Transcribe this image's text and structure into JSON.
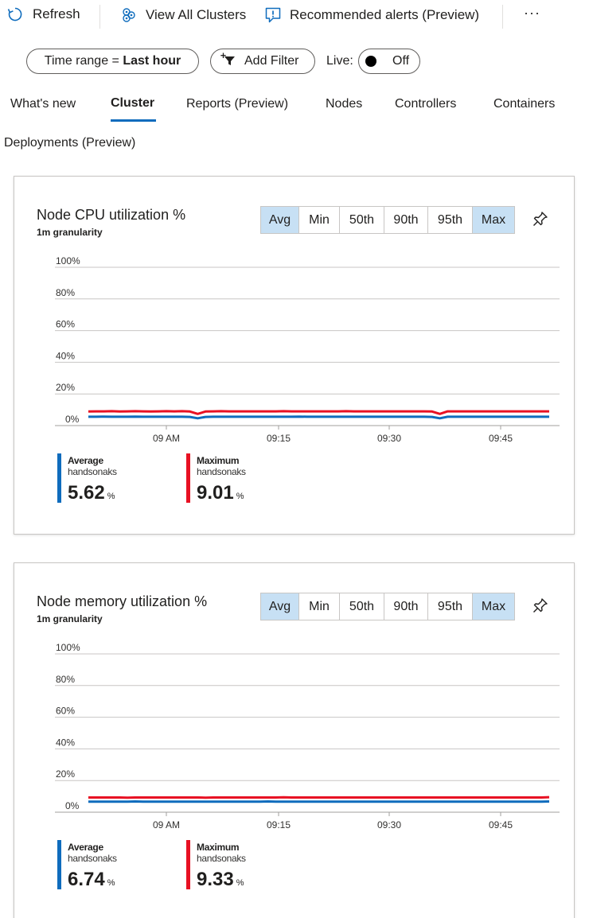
{
  "toolbar": {
    "refresh_label": "Refresh",
    "view_all_clusters_label": "View All Clusters",
    "recommended_alerts_label": "Recommended alerts (Preview)",
    "more_label": "···"
  },
  "filters": {
    "time_range_prefix": "Time range = ",
    "time_range_value": "Last hour",
    "add_filter_label": "Add Filter",
    "live_label": "Live:",
    "live_state": "Off"
  },
  "tabs": [
    {
      "label": "What's new",
      "active": false
    },
    {
      "label": "Cluster",
      "active": true
    },
    {
      "label": "Reports (Preview)",
      "active": false
    },
    {
      "label": "Nodes",
      "active": false
    },
    {
      "label": "Controllers",
      "active": false
    },
    {
      "label": "Containers",
      "active": false
    },
    {
      "label": "Deployments (Preview)",
      "active": false
    }
  ],
  "colors": {
    "accent": "#0f6cbd",
    "selected_segment": "#c7e0f4",
    "average_series": "#0f6cbd",
    "maximum_series": "#e81123"
  },
  "charts": [
    {
      "title": "Node CPU utilization %",
      "subtitle": "1m granularity",
      "aggregations": [
        {
          "label": "Avg",
          "selected": true
        },
        {
          "label": "Min",
          "selected": false
        },
        {
          "label": "50th",
          "selected": false
        },
        {
          "label": "90th",
          "selected": false
        },
        {
          "label": "95th",
          "selected": false
        },
        {
          "label": "Max",
          "selected": true
        }
      ],
      "legend": [
        {
          "name": "Average",
          "cluster": "handsonaks",
          "value": "5.62",
          "unit": "%"
        },
        {
          "name": "Maximum",
          "cluster": "handsonaks",
          "value": "9.01",
          "unit": "%"
        }
      ]
    },
    {
      "title": "Node memory utilization %",
      "subtitle": "1m granularity",
      "aggregations": [
        {
          "label": "Avg",
          "selected": true
        },
        {
          "label": "Min",
          "selected": false
        },
        {
          "label": "50th",
          "selected": false
        },
        {
          "label": "90th",
          "selected": false
        },
        {
          "label": "95th",
          "selected": false
        },
        {
          "label": "Max",
          "selected": true
        }
      ],
      "legend": [
        {
          "name": "Average",
          "cluster": "handsonaks",
          "value": "6.74",
          "unit": "%"
        },
        {
          "name": "Maximum",
          "cluster": "handsonaks",
          "value": "9.33",
          "unit": "%"
        }
      ]
    }
  ],
  "chart_data": [
    {
      "type": "line",
      "title": "Node CPU utilization %",
      "xlabel": "",
      "ylabel": "",
      "x_tick_labels": [
        "09 AM",
        "09:15",
        "09:30",
        "09:45"
      ],
      "y_tick_labels": [
        "0%",
        "20%",
        "40%",
        "60%",
        "80%",
        "100%"
      ],
      "ylim": [
        0,
        100
      ],
      "grid": true,
      "series": [
        {
          "name": "Average",
          "color": "#0f6cbd",
          "values": [
            5.6,
            5.6,
            5.7,
            5.6,
            5.6,
            5.6,
            5.7,
            5.6,
            5.6,
            5.6,
            5.6,
            5.6,
            5.6,
            5.5,
            4.6,
            5.5,
            5.6,
            5.6,
            5.6,
            5.6,
            5.6,
            5.6,
            5.6,
            5.6,
            5.6,
            5.6,
            5.6,
            5.7,
            5.6,
            5.6,
            5.6,
            5.6,
            5.6,
            5.6,
            5.6,
            5.6,
            5.6,
            5.6,
            5.6,
            5.6,
            5.6,
            5.6,
            5.6,
            5.6,
            5.5,
            4.6,
            5.6,
            5.6,
            5.6,
            5.6,
            5.6,
            5.6,
            5.6,
            5.6,
            5.6,
            5.6,
            5.6,
            5.6,
            5.6,
            5.6
          ]
        },
        {
          "name": "Maximum",
          "color": "#e81123",
          "values": [
            8.9,
            9.0,
            9.0,
            9.1,
            8.9,
            9.0,
            9.1,
            9.0,
            8.9,
            9.0,
            9.1,
            9.0,
            9.1,
            8.9,
            7.4,
            8.9,
            9.0,
            9.1,
            9.0,
            9.0,
            9.0,
            9.0,
            9.0,
            9.0,
            9.0,
            9.1,
            9.0,
            9.0,
            9.0,
            9.0,
            9.0,
            9.0,
            9.0,
            9.1,
            9.0,
            9.0,
            9.0,
            9.0,
            9.0,
            9.0,
            9.0,
            9.0,
            9.0,
            9.0,
            8.9,
            7.4,
            9.0,
            9.0,
            9.0,
            9.0,
            9.0,
            9.0,
            9.0,
            9.0,
            9.0,
            9.0,
            9.0,
            9.0,
            9.0,
            9.0
          ]
        }
      ]
    },
    {
      "type": "line",
      "title": "Node memory utilization %",
      "xlabel": "",
      "ylabel": "",
      "x_tick_labels": [
        "09 AM",
        "09:15",
        "09:30",
        "09:45"
      ],
      "y_tick_labels": [
        "0%",
        "20%",
        "40%",
        "60%",
        "80%",
        "100%"
      ],
      "ylim": [
        0,
        100
      ],
      "grid": true,
      "series": [
        {
          "name": "Average",
          "color": "#0f6cbd",
          "values": [
            6.7,
            6.7,
            6.7,
            6.7,
            6.7,
            6.7,
            6.8,
            6.7,
            6.7,
            6.7,
            6.7,
            6.7,
            6.7,
            6.7,
            6.7,
            6.7,
            6.7,
            6.7,
            6.7,
            6.7,
            6.7,
            6.7,
            6.7,
            6.8,
            6.7,
            6.7,
            6.7,
            6.7,
            6.7,
            6.7,
            6.7,
            6.7,
            6.7,
            6.7,
            6.7,
            6.7,
            6.7,
            6.7,
            6.7,
            6.7,
            6.7,
            6.7,
            6.7,
            6.7,
            6.7,
            6.7,
            6.7,
            6.7,
            6.7,
            6.7,
            6.7,
            6.7,
            6.7,
            6.7,
            6.7,
            6.7,
            6.7,
            6.7,
            6.7,
            6.8
          ]
        },
        {
          "name": "Maximum",
          "color": "#e81123",
          "values": [
            9.3,
            9.3,
            9.3,
            9.3,
            9.3,
            9.2,
            9.3,
            9.3,
            9.3,
            9.3,
            9.3,
            9.3,
            9.3,
            9.3,
            9.3,
            9.2,
            9.3,
            9.3,
            9.3,
            9.3,
            9.3,
            9.3,
            9.3,
            9.3,
            9.3,
            9.4,
            9.3,
            9.3,
            9.3,
            9.3,
            9.3,
            9.3,
            9.3,
            9.3,
            9.3,
            9.3,
            9.3,
            9.3,
            9.3,
            9.3,
            9.3,
            9.3,
            9.3,
            9.3,
            9.3,
            9.3,
            9.3,
            9.3,
            9.3,
            9.3,
            9.3,
            9.3,
            9.3,
            9.3,
            9.3,
            9.3,
            9.3,
            9.3,
            9.3,
            9.5
          ]
        }
      ]
    }
  ]
}
